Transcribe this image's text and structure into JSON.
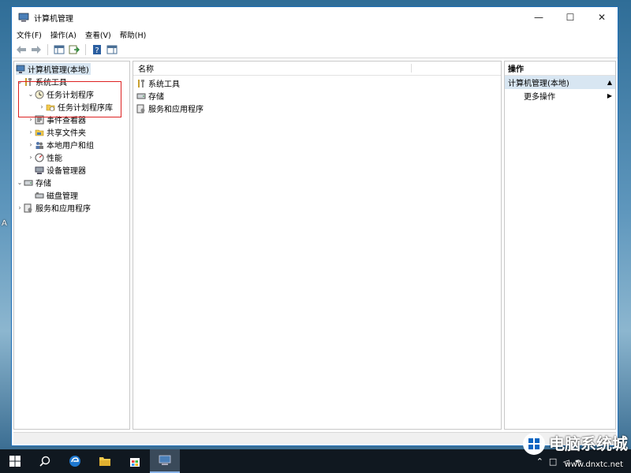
{
  "window": {
    "title": "计算机管理"
  },
  "menu": [
    "文件(F)",
    "操作(A)",
    "查看(V)",
    "帮助(H)"
  ],
  "tree": {
    "root": "计算机管理(本地)",
    "system_tools": "系统工具",
    "task_scheduler": "任务计划程序",
    "task_scheduler_library": "任务计划程序库",
    "event_viewer": "事件查看器",
    "shared_folders": "共享文件夹",
    "local_users": "本地用户和组",
    "performance": "性能",
    "device_manager": "设备管理器",
    "storage": "存储",
    "disk_management": "磁盘管理",
    "services_apps": "服务和应用程序"
  },
  "list": {
    "column_name": "名称",
    "items": [
      "系统工具",
      "存储",
      "服务和应用程序"
    ]
  },
  "actions": {
    "header": "操作",
    "selected": "计算机管理(本地)",
    "more": "更多操作"
  },
  "desktop": {
    "left_label": "A"
  },
  "watermark": {
    "text": "电脑系统城",
    "url": "www.dnxtc.net"
  },
  "colors": {
    "accent": "#1e6fb8",
    "highlight_box": "#dd2222"
  }
}
